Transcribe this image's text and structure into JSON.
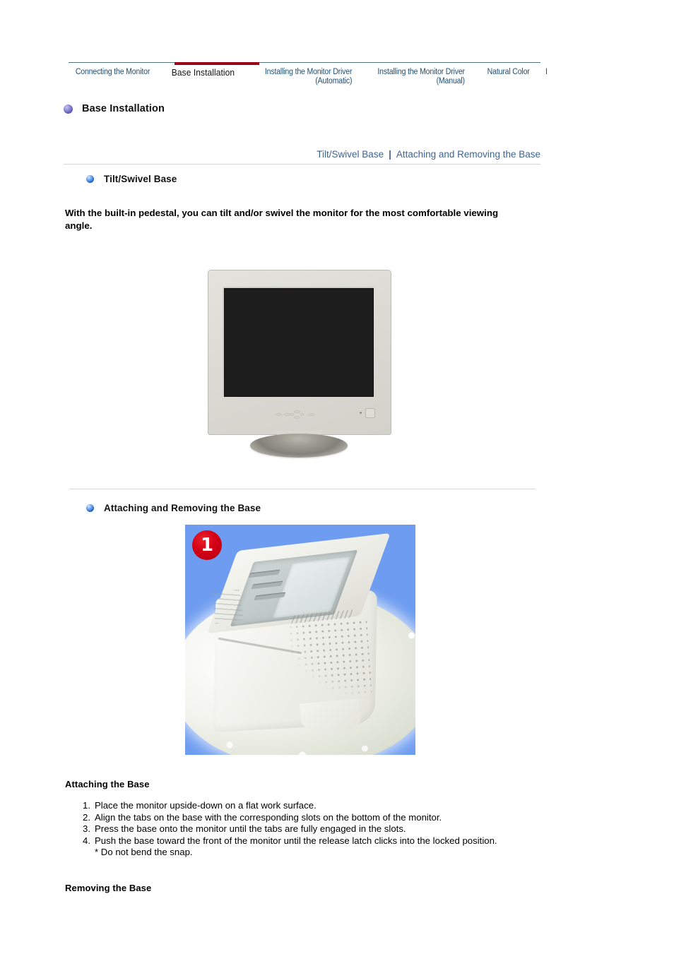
{
  "tabbar": {
    "tabs": [
      {
        "label": "Connecting the Monitor",
        "active": false
      },
      {
        "label": "Base Installation",
        "active": true
      },
      {
        "label": "Installing the Monitor Driver\n(Automatic)",
        "active": false
      },
      {
        "label": "Installing the Monitor Driver\n(Manual)",
        "active": false
      },
      {
        "label": "Natural Color",
        "active": false
      },
      {
        "label": "I",
        "active": false
      }
    ],
    "active_color": "#9b0017",
    "link_color": "#1d4f77"
  },
  "page": {
    "title": "Base Installation",
    "bullet_color": "#5b56b4"
  },
  "subnav": {
    "links": [
      "Tilt/Swivel Base",
      "Attaching and Removing the Base"
    ],
    "separator": "|",
    "color": "#3f6494"
  },
  "sections": [
    {
      "heading": "Tilt/Swivel Base",
      "intro": "With the built-in pedestal, you can tilt and/or swivel the monitor for the most comfortable viewing angle."
    },
    {
      "heading": "Attaching and Removing the Base"
    }
  ],
  "figure": {
    "badge": "1",
    "badge_color": "#d40016",
    "background_color": "#6d9cf0"
  },
  "attaching": {
    "heading": "Attaching the Base",
    "steps": [
      {
        "num": "1.",
        "text": "Place the monitor upside-down on a flat work surface."
      },
      {
        "num": "2.",
        "text": "Align the tabs on the base with the corresponding slots on the bottom of the monitor."
      },
      {
        "num": "3.",
        "text": "Press the base onto the monitor until the tabs are fully engaged in the slots."
      },
      {
        "num": "4.",
        "text": "Push the base toward the front of the monitor until the release latch clicks into the locked position.",
        "note": "* Do not bend the snap."
      }
    ]
  },
  "removing": {
    "heading": "Removing the Base"
  }
}
